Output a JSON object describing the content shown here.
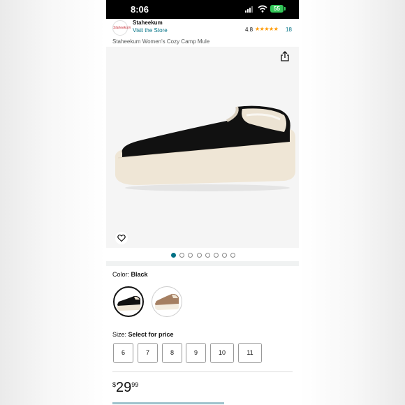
{
  "status_bar": {
    "time": "8:06",
    "battery": "55"
  },
  "seller": {
    "logo_text": "Staheekum",
    "name": "Staheekum",
    "visit_store": "Visit the Store",
    "rating": "4.8",
    "stars": "★★★★★",
    "review_count": "18"
  },
  "product": {
    "title": "Staheekum Women's Cozy Camp Mule"
  },
  "gallery": {
    "image_count": 8,
    "active_index": 0
  },
  "color": {
    "label": "Color:",
    "selected": "Black",
    "options": [
      "Black",
      "Tan"
    ]
  },
  "size": {
    "label": "Size:",
    "prompt": "Select for price",
    "options": [
      "6",
      "7",
      "8",
      "9",
      "10",
      "11"
    ]
  },
  "price": {
    "currency": "$",
    "whole": "29",
    "fraction": "99"
  },
  "colors": {
    "link": "#007185",
    "star": "#ff9900",
    "battery": "#34c759"
  },
  "icons": [
    "signal-icon",
    "wifi-icon",
    "battery-icon",
    "share-icon",
    "heart-icon"
  ]
}
